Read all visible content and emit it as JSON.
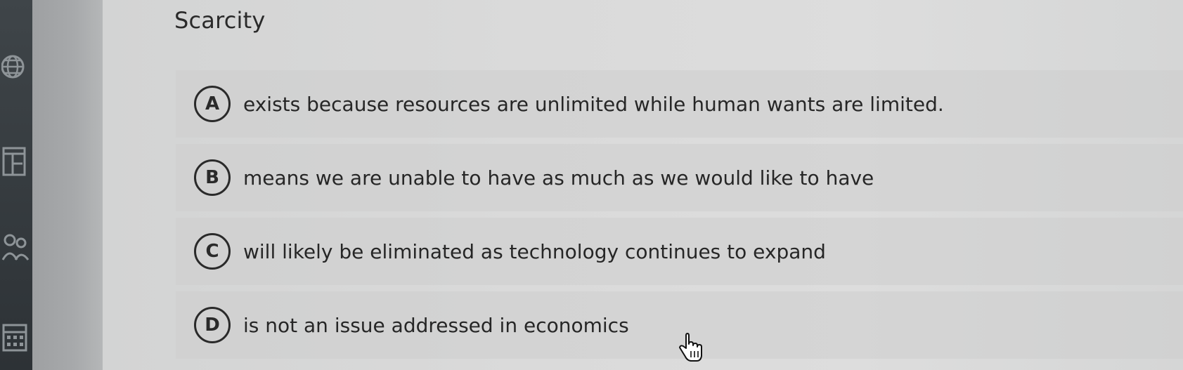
{
  "question": {
    "title": "Scarcity"
  },
  "choices": [
    {
      "letter": "A",
      "text": "exists because resources are unlimited while human wants are limited."
    },
    {
      "letter": "B",
      "text": "means we are unable to have as much as we would like to have"
    },
    {
      "letter": "C",
      "text": "will likely be eliminated as technology continues to expand"
    },
    {
      "letter": "D",
      "text": "is not an issue addressed in economics"
    }
  ],
  "sidebar": {
    "icons": [
      "globe-icon",
      "book-icon",
      "people-icon",
      "calendar-icon"
    ]
  },
  "colors": {
    "rail": "#353a3e",
    "text": "#262626",
    "choice_bg": "#cdcece"
  }
}
